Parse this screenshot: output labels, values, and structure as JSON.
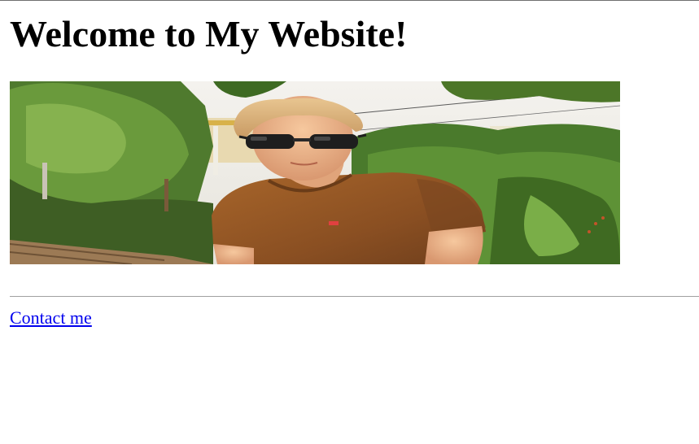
{
  "heading": "Welcome to My Website!",
  "links": {
    "contact_label": "Contact me"
  },
  "colors": {
    "link": "#0000ee",
    "text": "#000000",
    "rule": "#a0a0a0"
  }
}
